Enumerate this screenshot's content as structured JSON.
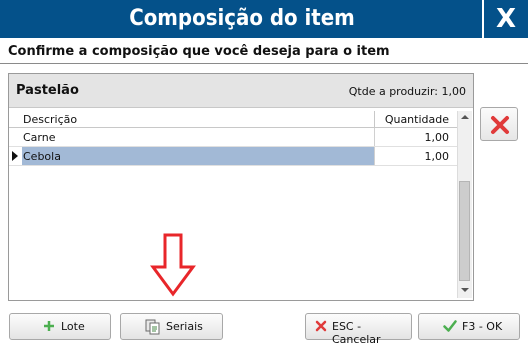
{
  "window": {
    "title": "Composição do item",
    "close_label": "X"
  },
  "subtitle": "Confirme a composição que você deseja para o item",
  "panel": {
    "item_name": "Pastelão",
    "qty_label": "Qtde a produzir: 1,00"
  },
  "grid": {
    "columns": [
      "Descrição",
      "Quantidade"
    ],
    "rows": [
      {
        "descricao": "Carne",
        "quantidade": "1,00",
        "selected": false
      },
      {
        "descricao": "Cebola",
        "quantidade": "1,00",
        "selected": true
      }
    ]
  },
  "buttons": {
    "lote": "Lote",
    "seriais": "Seriais",
    "cancel": "ESC - Cancelar",
    "ok": "F3 - OK"
  },
  "icons": {
    "lote": "plus-icon",
    "seriais": "copy-icon",
    "cancel": "x-icon",
    "ok": "check-icon",
    "delete": "delete-x-icon",
    "annotation": "red-down-arrow"
  },
  "colors": {
    "titlebar": "#04518a",
    "selection": "#a2b9d6",
    "accent_red": "#e03a3a",
    "accent_green": "#4caf50"
  }
}
